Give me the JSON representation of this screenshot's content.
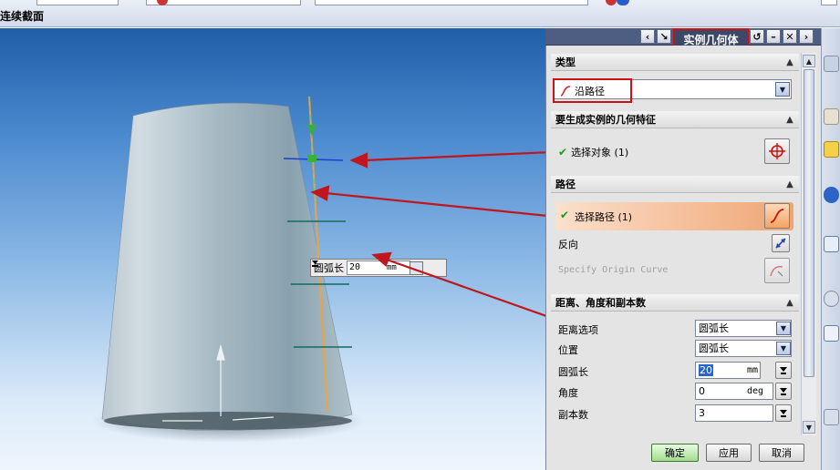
{
  "document": {
    "title": "连续截面"
  },
  "viewport": {
    "inline_input": {
      "label": "圆弧长",
      "value": "20",
      "unit": "mm"
    }
  },
  "dialog": {
    "title": "实例几何体",
    "type_section": {
      "header": "类型",
      "selected": "沿路径"
    },
    "geometry_section": {
      "header": "要生成实例的几何特征",
      "select_label": "选择对象 (1)"
    },
    "path_section": {
      "header": "路径",
      "select_label": "选择路径 (1)",
      "reverse_label": "反向",
      "origin_curve_label": "Specify Origin Curve"
    },
    "distance_section": {
      "header": "距离、角度和副本数",
      "fields": [
        {
          "label": "距离选项",
          "value": "圆弧长",
          "unit": ""
        },
        {
          "label": "位置",
          "value": "圆弧长",
          "unit": ""
        },
        {
          "label": "圆弧长",
          "value": "20",
          "unit": "mm"
        },
        {
          "label": "角度",
          "value": "0",
          "unit": "deg"
        },
        {
          "label": "副本数",
          "value": "3",
          "unit": ""
        }
      ]
    },
    "buttons": {
      "ok": "确定",
      "apply": "应用",
      "cancel": "取消"
    }
  },
  "colors": {
    "annotation": "#c0161d",
    "path_line": "#f0a23c",
    "accent_row": "#efa574",
    "check": "#1b9a1b"
  }
}
